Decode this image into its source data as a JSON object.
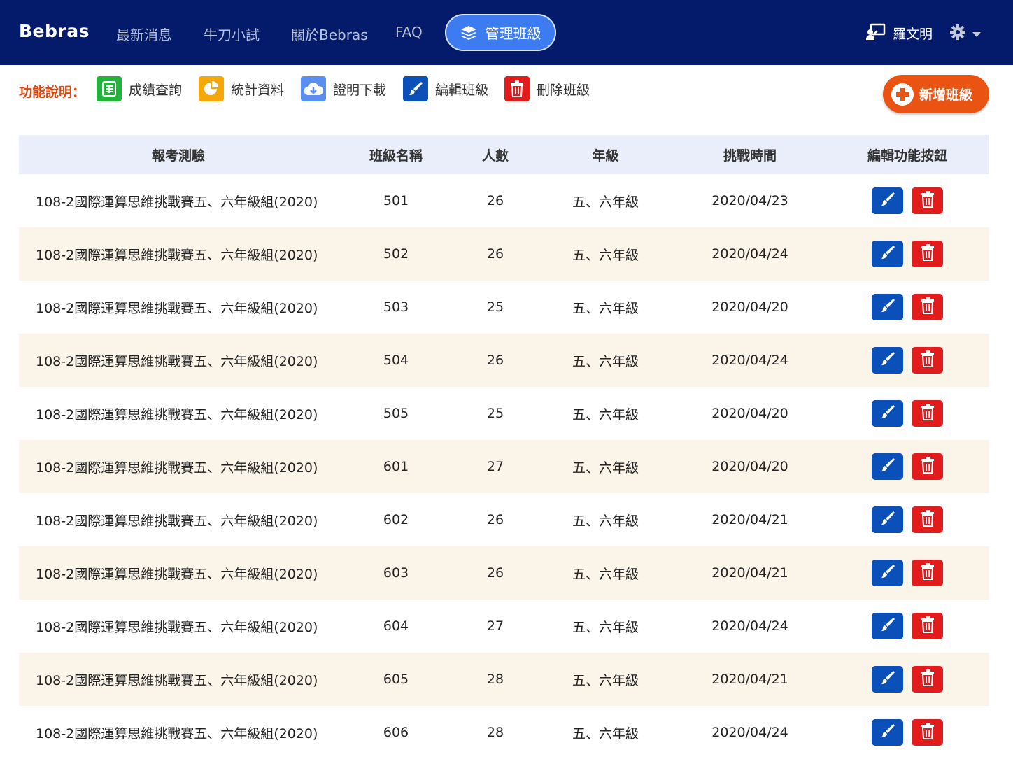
{
  "navbar": {
    "brand": "Bebras",
    "links": [
      "最新消息",
      "牛刀小試",
      "關於Bebras",
      "FAQ"
    ],
    "active": "管理班級",
    "user_name": "羅文明"
  },
  "legend": {
    "title": "功能說明：",
    "items": [
      {
        "label": "成績查詢",
        "icon": "score-sheet-icon",
        "color": "#22b33a"
      },
      {
        "label": "統計資料",
        "icon": "pie-chart-icon",
        "color": "#f5a70a"
      },
      {
        "label": "證明下載",
        "icon": "cloud-download-icon",
        "color": "#5b8ef0"
      },
      {
        "label": "編輯班級",
        "icon": "brush-icon",
        "color": "#0b4fb8"
      },
      {
        "label": "刪除班級",
        "icon": "trash-icon",
        "color": "#e21c1c"
      }
    ]
  },
  "add_button": {
    "label": "新增班級"
  },
  "table": {
    "headers": [
      "報考測驗",
      "班級名稱",
      "人數",
      "年級",
      "挑戰時間",
      "編輯功能按鈕"
    ],
    "rows": [
      {
        "exam": "108-2國際運算思維挑戰賽五、六年級組(2020)",
        "class": "501",
        "count": "26",
        "grade": "五、六年級",
        "date": "2020/04/23"
      },
      {
        "exam": "108-2國際運算思維挑戰賽五、六年級組(2020)",
        "class": "502",
        "count": "26",
        "grade": "五、六年級",
        "date": "2020/04/24"
      },
      {
        "exam": "108-2國際運算思維挑戰賽五、六年級組(2020)",
        "class": "503",
        "count": "25",
        "grade": "五、六年級",
        "date": "2020/04/20"
      },
      {
        "exam": "108-2國際運算思維挑戰賽五、六年級組(2020)",
        "class": "504",
        "count": "26",
        "grade": "五、六年級",
        "date": "2020/04/24"
      },
      {
        "exam": "108-2國際運算思維挑戰賽五、六年級組(2020)",
        "class": "505",
        "count": "25",
        "grade": "五、六年級",
        "date": "2020/04/20"
      },
      {
        "exam": "108-2國際運算思維挑戰賽五、六年級組(2020)",
        "class": "601",
        "count": "27",
        "grade": "五、六年級",
        "date": "2020/04/20"
      },
      {
        "exam": "108-2國際運算思維挑戰賽五、六年級組(2020)",
        "class": "602",
        "count": "26",
        "grade": "五、六年級",
        "date": "2020/04/21"
      },
      {
        "exam": "108-2國際運算思維挑戰賽五、六年級組(2020)",
        "class": "603",
        "count": "26",
        "grade": "五、六年級",
        "date": "2020/04/21"
      },
      {
        "exam": "108-2國際運算思維挑戰賽五、六年級組(2020)",
        "class": "604",
        "count": "27",
        "grade": "五、六年級",
        "date": "2020/04/24"
      },
      {
        "exam": "108-2國際運算思維挑戰賽五、六年級組(2020)",
        "class": "605",
        "count": "28",
        "grade": "五、六年級",
        "date": "2020/04/21"
      },
      {
        "exam": "108-2國際運算思維挑戰賽五、六年級組(2020)",
        "class": "606",
        "count": "28",
        "grade": "五、六年級",
        "date": "2020/04/24"
      }
    ]
  }
}
